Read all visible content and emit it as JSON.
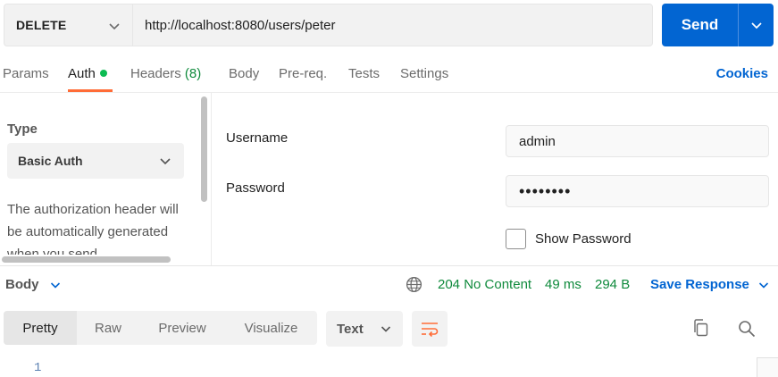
{
  "request": {
    "method": "DELETE",
    "url": "http://localhost:8080/users/peter",
    "send_label": "Send"
  },
  "tabs": {
    "params": "Params",
    "auth": "Auth",
    "headers": "Headers",
    "headers_count": "(8)",
    "body": "Body",
    "prereq": "Pre-req.",
    "tests": "Tests",
    "settings": "Settings",
    "cookies": "Cookies"
  },
  "auth": {
    "type_label": "Type",
    "type_value": "Basic Auth",
    "description": "The authorization header will be automatically generated when you send",
    "username_label": "Username",
    "username_value": "admin",
    "password_label": "Password",
    "password_value": "••••••••",
    "show_password_label": "Show Password"
  },
  "response": {
    "body_label": "Body",
    "status": "204 No Content",
    "time": "49 ms",
    "size": "294 B",
    "save_label": "Save Response"
  },
  "viewer": {
    "tabs": [
      "Pretty",
      "Raw",
      "Preview",
      "Visualize"
    ],
    "format": "Text",
    "line_numbers": [
      "1"
    ]
  },
  "colors": {
    "accent": "#0265d2",
    "active_tab": "#ff6c37",
    "success": "#0f8a3c"
  }
}
